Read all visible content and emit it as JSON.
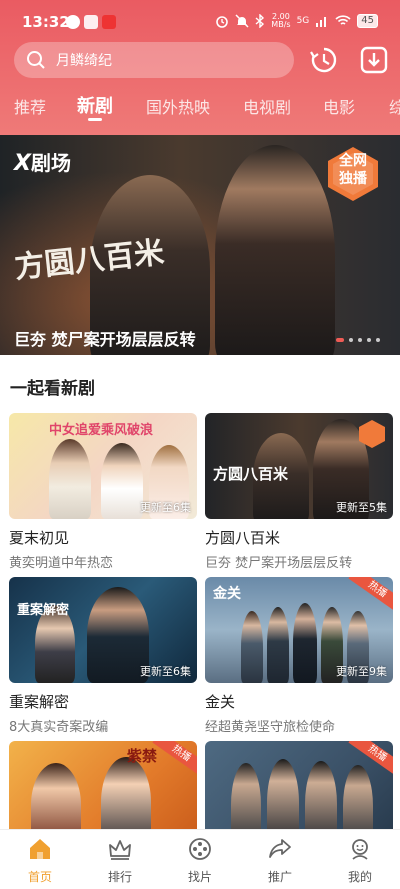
{
  "status_bar": {
    "time": "13:32",
    "network_speed": "2.00",
    "network_unit": "MB/s",
    "signal_label": "5G",
    "battery": "45"
  },
  "search": {
    "placeholder": "月鳞绮纪"
  },
  "tabs": [
    {
      "label": "推荐",
      "active": false
    },
    {
      "label": "新剧",
      "active": true
    },
    {
      "label": "国外热映",
      "active": false
    },
    {
      "label": "电视剧",
      "active": false
    },
    {
      "label": "电影",
      "active": false
    },
    {
      "label": "综",
      "active": false
    }
  ],
  "banner": {
    "logo_mark": "X",
    "logo_text": "剧场",
    "exclusive_badge_line1": "全网",
    "exclusive_badge_line2": "独播",
    "title_art": "方圆八百米",
    "caption": "巨夯 焚尸案开场层层反转",
    "dots_total": 5,
    "dots_active": 1
  },
  "section": {
    "title": "一起看新剧"
  },
  "cards": [
    {
      "name": "夏末初见",
      "desc": "黄奕明道中年热恋",
      "update": "更新至6集",
      "art_text": "中女追爱乘风破浪",
      "ribbon": ""
    },
    {
      "name": "方圆八百米",
      "desc": "巨夯 焚尸案开场层层反转",
      "update": "更新至5集",
      "art_text": "方圆八百米",
      "ribbon": ""
    },
    {
      "name": "重案解密",
      "desc": "8大真实奇案改编",
      "update": "更新至6集",
      "art_text": "重案解密",
      "ribbon": ""
    },
    {
      "name": "金关",
      "desc": "经超黄尧坚守旅检使命",
      "update": "更新至9集",
      "art_text": "金关",
      "ribbon": "热播"
    },
    {
      "name": "",
      "desc": "",
      "update": "",
      "art_text": "紫禁",
      "ribbon": "热播"
    },
    {
      "name": "",
      "desc": "",
      "update": "",
      "art_text": "",
      "ribbon": "热播"
    }
  ],
  "bottom_nav": [
    {
      "label": "首页",
      "icon": "home-icon",
      "active": true
    },
    {
      "label": "排行",
      "icon": "crown-icon",
      "active": false
    },
    {
      "label": "找片",
      "icon": "film-reel-icon",
      "active": false
    },
    {
      "label": "推广",
      "icon": "share-icon",
      "active": false
    },
    {
      "label": "我的",
      "icon": "profile-icon",
      "active": false
    }
  ],
  "colors": {
    "header_red": "#ea5b62",
    "accent_orange": "#f0a030",
    "ribbon_red": "#e9563f"
  }
}
